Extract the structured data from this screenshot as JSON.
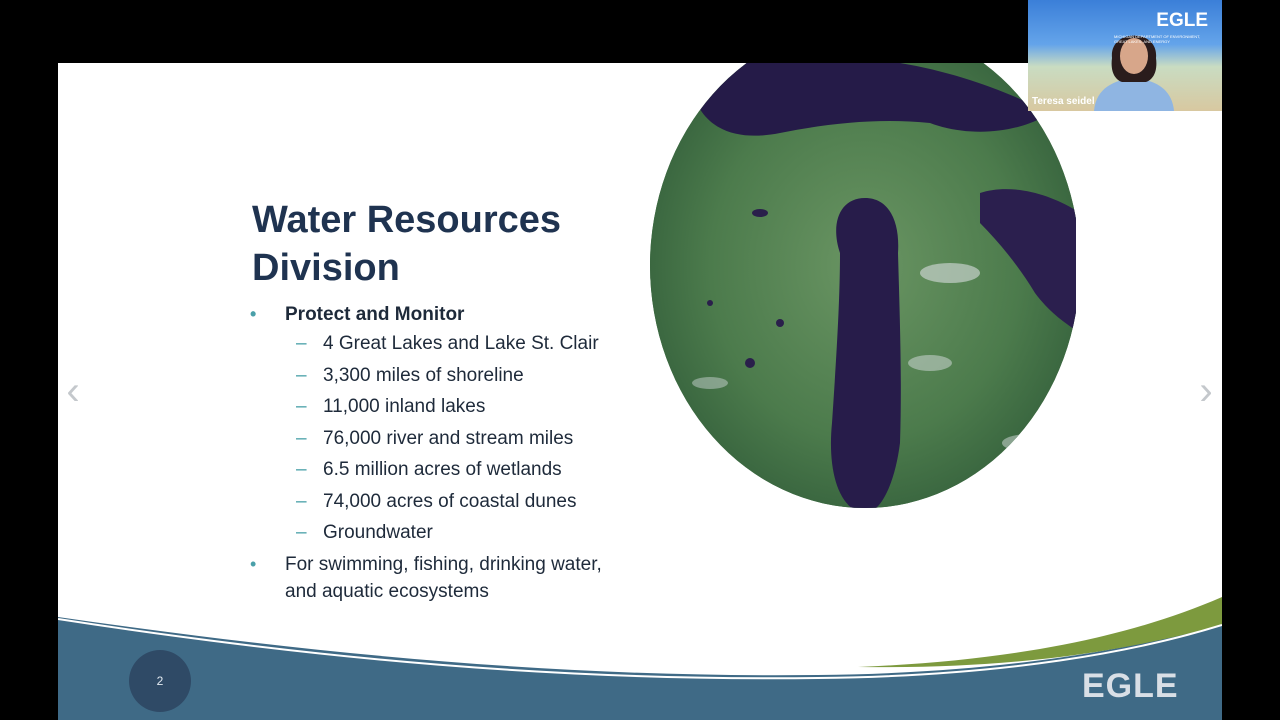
{
  "slide": {
    "title": "Water Resources Division",
    "bullets": [
      {
        "text": "Protect and Monitor",
        "subitems": [
          "4 Great Lakes and Lake St. Clair",
          "3,300 miles of shoreline",
          "11,000 inland lakes",
          "76,000 river and stream miles",
          "6.5 million acres of wetlands",
          "74,000 acres of coastal dunes",
          "Groundwater"
        ]
      },
      {
        "text": "For swimming, fishing, drinking water, and aquatic ecosystems"
      }
    ],
    "page_number": "2",
    "logo": "EGLE"
  },
  "navigation": {
    "prev_icon": "chevron-left-icon",
    "next_icon": "chevron-right-icon",
    "prev_glyph": "‹",
    "next_glyph": "›"
  },
  "webcam": {
    "brand": "EGLE",
    "brand_sub": "MICHIGAN DEPARTMENT OF ENVIRONMENT, GREAT LAKES, AND ENERGY",
    "participant_name": "Teresa seidel"
  },
  "colors": {
    "title": "#1f3350",
    "accent": "#4aa0a9",
    "wave_blue": "#3f6a86",
    "wave_green": "#7d9a3e",
    "background": "#000000"
  }
}
